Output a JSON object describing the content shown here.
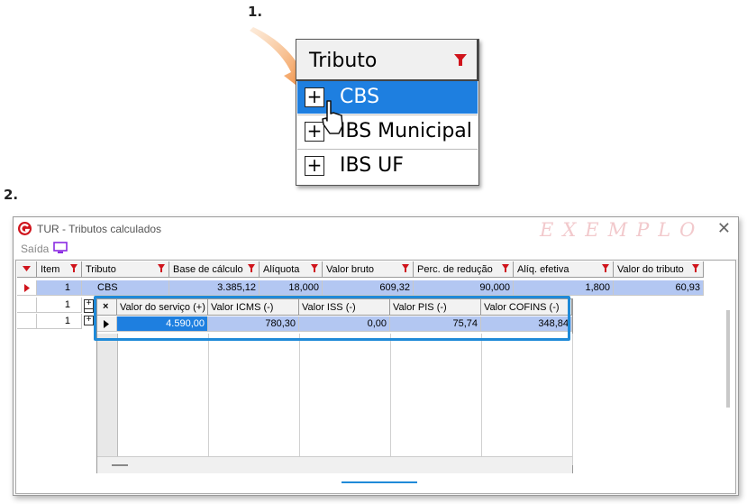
{
  "steps": {
    "one": "1.",
    "two": "2."
  },
  "zoom": {
    "header": "Tributo",
    "rows": [
      {
        "label": "CBS",
        "selected": true
      },
      {
        "label": "IBS Municipal",
        "selected": false
      },
      {
        "label": "IBS UF",
        "selected": false
      }
    ]
  },
  "window": {
    "title": "TUR - Tributos calculados",
    "watermark": "EXEMPLO",
    "close": "✕",
    "toolbar": {
      "saida": "Saída"
    }
  },
  "grid": {
    "columns": [
      "Item",
      "Tributo",
      "Base de cálculo",
      "Alíquota",
      "Valor bruto",
      "Perc. de redução",
      "Alíq. efetiva",
      "Valor do tributo"
    ],
    "rows": [
      {
        "item": "1",
        "tributo": "CBS",
        "base": "3.385,12",
        "aliquota": "18,000",
        "bruto": "609,32",
        "reducao": "90,000",
        "efetiva": "1,800",
        "tributo_valor": "60,93"
      },
      {
        "item": "1"
      },
      {
        "item": "1"
      }
    ]
  },
  "detail": {
    "columns": [
      "Valor do serviço (+)",
      "Valor ICMS (-)",
      "Valor ISS (-)",
      "Valor PIS (-)",
      "Valor COFINS (-)"
    ],
    "row": [
      "4.590,00",
      "780,30",
      "0,00",
      "75,74",
      "348,84"
    ]
  },
  "colors": {
    "accent": "#1f8ad8",
    "filter": "#d0141c",
    "selection": "#b3c7f2",
    "cursor_arrow": "#f0822d"
  }
}
